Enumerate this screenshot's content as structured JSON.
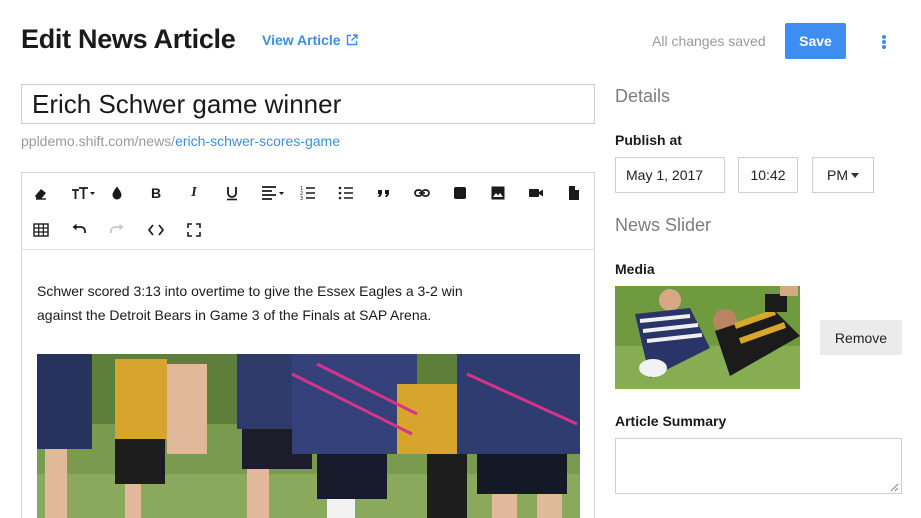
{
  "header": {
    "title": "Edit News Article",
    "view_link": "View Article",
    "save_status": "All changes saved",
    "save_label": "Save"
  },
  "article": {
    "title": "Erich Schwer game winner",
    "slug_base": "ppldemo.shift.com/news/",
    "slug": "erich-schwer-scores-game",
    "body_line_1": "Schwer scored 3:13 into overtime to give the Essex Eagles a 3-2 win",
    "body_line_2": "against the Detroit Bears in Game 3 of the Finals at SAP Arena."
  },
  "toolbar": {
    "row1": [
      "eraser-icon",
      "text-size-icon",
      "color-icon",
      "bold-icon",
      "italic-icon",
      "underline-icon",
      "align-icon",
      "ordered-list-icon",
      "bullet-list-icon",
      "quote-icon",
      "link-icon",
      "embed-icon",
      "image-icon",
      "video-icon",
      "file-icon"
    ],
    "row2": [
      "table-icon",
      "undo-icon",
      "redo-icon",
      "code-icon",
      "fullscreen-icon"
    ]
  },
  "sidebar": {
    "details_heading": "Details",
    "publish_label": "Publish at",
    "date": "May 1, 2017",
    "time": "10:42",
    "ampm": "PM",
    "slider_heading": "News Slider",
    "media_label": "Media",
    "remove_label": "Remove",
    "summary_label": "Article Summary"
  },
  "colors": {
    "accent": "#3d8ef0",
    "link": "#3d8de0",
    "muted": "#9a9a9a"
  }
}
